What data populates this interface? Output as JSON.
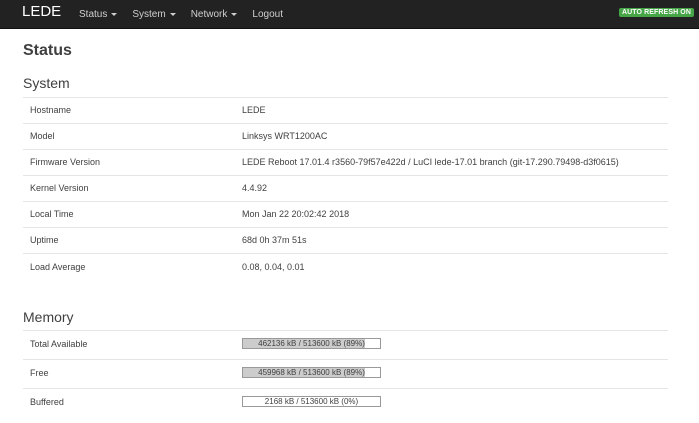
{
  "nav": {
    "brand": "LEDE",
    "menu": [
      "Status",
      "System",
      "Network",
      "Logout"
    ],
    "auto_refresh": "AUTO REFRESH ON"
  },
  "page_title": "Status",
  "system": {
    "heading": "System",
    "rows": [
      {
        "label": "Hostname",
        "value": "LEDE"
      },
      {
        "label": "Model",
        "value": "Linksys WRT1200AC"
      },
      {
        "label": "Firmware Version",
        "value": "LEDE Reboot 17.01.4 r3560-79f57e422d / LuCI lede-17.01 branch (git-17.290.79498-d3f0615)"
      },
      {
        "label": "Kernel Version",
        "value": "4.4.92"
      },
      {
        "label": "Local Time",
        "value": "Mon Jan 22 20:02:42 2018"
      },
      {
        "label": "Uptime",
        "value": "68d 0h 37m 51s"
      },
      {
        "label": "Load Average",
        "value": "0.08, 0.04, 0.01"
      }
    ]
  },
  "memory": {
    "heading": "Memory",
    "rows": [
      {
        "label": "Total Available",
        "text": "462136 kB / 513600 kB (89%)",
        "fraction": 0.89
      },
      {
        "label": "Free",
        "text": "459968 kB / 513600 kB (89%)",
        "fraction": 0.89
      },
      {
        "label": "Buffered",
        "text": "2168 kB / 513600 kB (0%)",
        "fraction": 0.0
      }
    ]
  },
  "colors": {
    "navbar": "#222222",
    "badge": "#46a546",
    "bar_fill": "#cccccc"
  }
}
